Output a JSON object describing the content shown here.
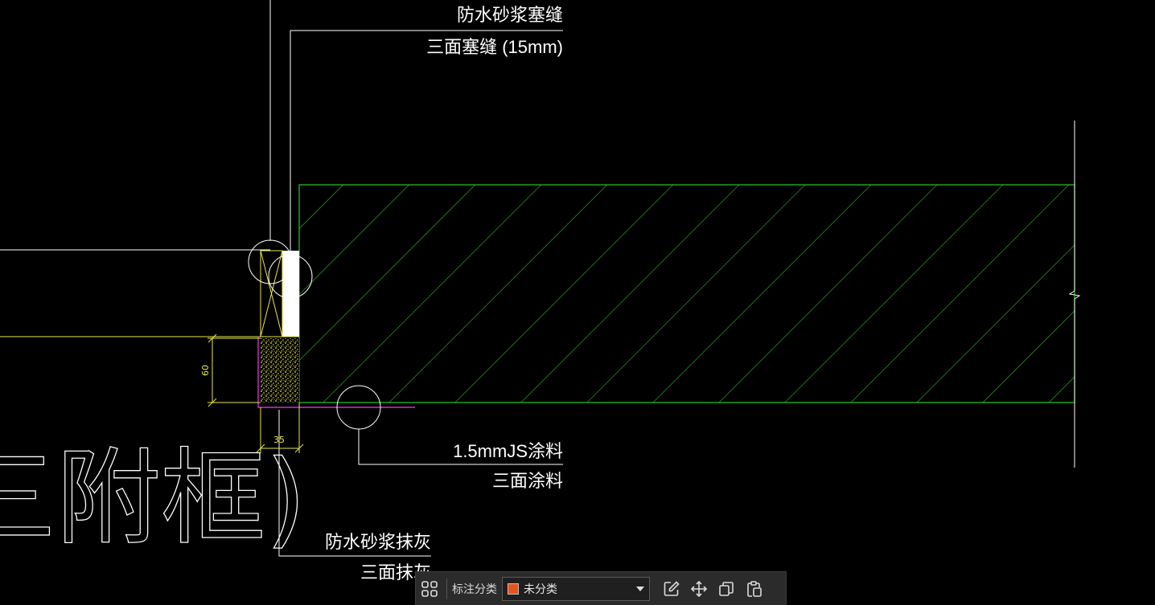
{
  "drawing": {
    "callouts": {
      "top_line1": "防水砂浆塞缝",
      "top_line2": "三面塞缝 (15mm)",
      "right_line1": "1.5mmJS涂料",
      "right_line2": "三面涂料",
      "bottom_line1": "防水砂浆抹灰",
      "bottom_line2": "三面抹灰"
    },
    "dimensions": {
      "height": "60",
      "width": "35"
    },
    "large_text": "三附框)",
    "colors": {
      "background": "#000000",
      "line": "#ffffff",
      "hatch": "#22cc22",
      "dimension": "#e8e84a",
      "mortar": "#e8e84a",
      "membrane": "#cc33cc"
    }
  },
  "toolbar": {
    "label": "标注分类",
    "category_value": "未分类",
    "category_color": "#e8531a",
    "icons": [
      "grid-icon",
      "edit-icon",
      "move-icon",
      "copy-icon",
      "paste-icon"
    ]
  }
}
